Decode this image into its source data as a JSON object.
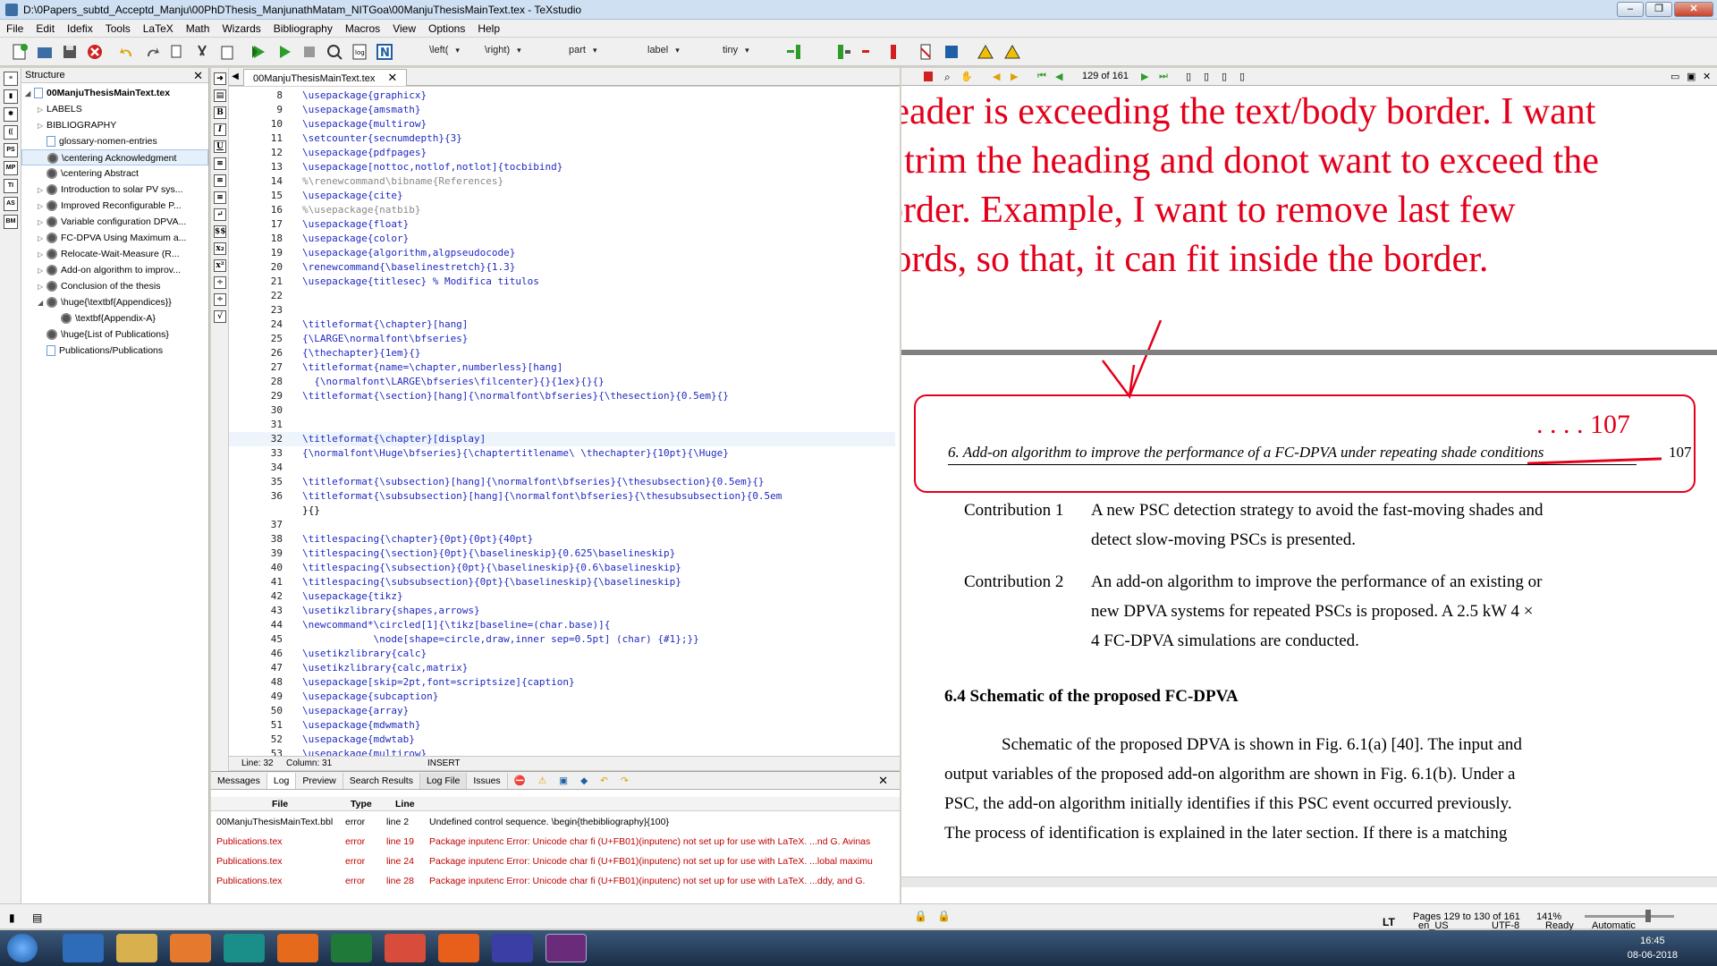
{
  "window": {
    "title": "D:\\0Papers_subtd_Acceptd_Manju\\00PhDThesis_ManjunathMatam_NITGoa\\00ManjuThesisMainText.tex - TeXstudio"
  },
  "menu": [
    "File",
    "Edit",
    "Idefix",
    "Tools",
    "LaTeX",
    "Math",
    "Wizards",
    "Bibliography",
    "Macros",
    "View",
    "Options",
    "Help"
  ],
  "toolbar": {
    "left": "\\left(",
    "right": "\\right)",
    "part": "part",
    "label": "label",
    "tiny": "tiny"
  },
  "structure": {
    "header": "Structure",
    "root": "00ManjuThesisMainText.tex",
    "items": [
      {
        "label": "LABELS",
        "kind": "folder"
      },
      {
        "label": "BIBLIOGRAPHY",
        "kind": "folder"
      },
      {
        "label": "glossary-nomen-entries",
        "kind": "file"
      },
      {
        "label": "\\centering Acknowledgment",
        "kind": "chapter"
      },
      {
        "label": "\\centering Abstract",
        "kind": "chapter"
      },
      {
        "label": "Introduction to solar PV sys...",
        "kind": "chapter"
      },
      {
        "label": "Improved Reconfigurable P...",
        "kind": "chapter"
      },
      {
        "label": "Variable configuration DPVA...",
        "kind": "chapter"
      },
      {
        "label": "FC-DPVA Using Maximum a...",
        "kind": "chapter"
      },
      {
        "label": "Relocate-Wait-Measure (R...",
        "kind": "chapter"
      },
      {
        "label": "Add-on algorithm to improv...",
        "kind": "chapter"
      },
      {
        "label": "Conclusion of the thesis",
        "kind": "chapter"
      },
      {
        "label": "\\huge{\\textbf{Appendices}}",
        "kind": "chapter"
      },
      {
        "label": "\\textbf{Appendix-A}",
        "kind": "section"
      },
      {
        "label": "\\huge{List of Publications}",
        "kind": "chapter"
      },
      {
        "label": "Publications/Publications",
        "kind": "file"
      }
    ]
  },
  "editor": {
    "tab": "00ManjuThesisMainText.tex",
    "lines": [
      {
        "n": "8",
        "t": "\\usepackage{graphicx}"
      },
      {
        "n": "9",
        "t": "\\usepackage{amsmath}"
      },
      {
        "n": "10",
        "t": "\\usepackage{multirow}"
      },
      {
        "n": "11",
        "t": "\\setcounter{secnumdepth}{3}"
      },
      {
        "n": "12",
        "t": "\\usepackage{pdfpages}"
      },
      {
        "n": "13",
        "t": "\\usepackage[nottoc,notlof,notlot]{tocbibind}"
      },
      {
        "n": "14",
        "t": "%\\renewcommand\\bibname{References}"
      },
      {
        "n": "15",
        "t": "\\usepackage{cite}"
      },
      {
        "n": "16",
        "t": "%\\usepackage{natbib}"
      },
      {
        "n": "17",
        "t": "\\usepackage{float}"
      },
      {
        "n": "18",
        "t": "\\usepackage{color}"
      },
      {
        "n": "19",
        "t": "\\usepackage{algorithm,algpseudocode}"
      },
      {
        "n": "20",
        "t": "\\renewcommand{\\baselinestretch}{1.3}"
      },
      {
        "n": "21",
        "t": "\\usepackage{titlesec} % Modifica titulos"
      },
      {
        "n": "22",
        "t": ""
      },
      {
        "n": "23",
        "t": ""
      },
      {
        "n": "24",
        "t": "\\titleformat{\\chapter}[hang]"
      },
      {
        "n": "25",
        "t": "{\\LARGE\\normalfont\\bfseries}"
      },
      {
        "n": "26",
        "t": "{\\thechapter}{1em}{}"
      },
      {
        "n": "27",
        "t": "\\titleformat{name=\\chapter,numberless}[hang]"
      },
      {
        "n": "28",
        "t": "  {\\normalfont\\LARGE\\bfseries\\filcenter}{}{1ex}{}{}"
      },
      {
        "n": "29",
        "t": "\\titleformat{\\section}[hang]{\\normalfont\\bfseries}{\\thesection}{0.5em}{}"
      },
      {
        "n": "30",
        "t": ""
      },
      {
        "n": "31",
        "t": ""
      },
      {
        "n": "32",
        "t": "\\titleformat{\\chapter}[display]"
      },
      {
        "n": "33",
        "t": "{\\normalfont\\Huge\\bfseries}{\\chaptertitlename\\ \\thechapter}{10pt}{\\Huge}"
      },
      {
        "n": "34",
        "t": ""
      },
      {
        "n": "35",
        "t": "\\titleformat{\\subsection}[hang]{\\normalfont\\bfseries}{\\thesubsection}{0.5em}{}"
      },
      {
        "n": "36",
        "t": "\\titleformat{\\subsubsection}[hang]{\\normalfont\\bfseries}{\\thesubsubsection}{0.5em"
      },
      {
        "n": "",
        "t": "}{}"
      },
      {
        "n": "37",
        "t": ""
      },
      {
        "n": "38",
        "t": "\\titlespacing{\\chapter}{0pt}{0pt}{40pt}"
      },
      {
        "n": "39",
        "t": "\\titlespacing{\\section}{0pt}{\\baselineskip}{0.625\\baselineskip}"
      },
      {
        "n": "40",
        "t": "\\titlespacing{\\subsection}{0pt}{\\baselineskip}{0.6\\baselineskip}"
      },
      {
        "n": "41",
        "t": "\\titlespacing{\\subsubsection}{0pt}{\\baselineskip}{\\baselineskip}"
      },
      {
        "n": "42",
        "t": "\\usepackage{tikz}"
      },
      {
        "n": "43",
        "t": "\\usetikzlibrary{shapes,arrows}"
      },
      {
        "n": "44",
        "t": "\\newcommand*\\circled[1]{\\tikz[baseline=(char.base)]{"
      },
      {
        "n": "45",
        "t": "            \\node[shape=circle,draw,inner sep=0.5pt] (char) {#1};}}"
      },
      {
        "n": "46",
        "t": "\\usetikzlibrary{calc}"
      },
      {
        "n": "47",
        "t": "\\usetikzlibrary{calc,matrix}"
      },
      {
        "n": "48",
        "t": "\\usepackage[skip=2pt,font=scriptsize]{caption}"
      },
      {
        "n": "49",
        "t": "\\usepackage{subcaption}"
      },
      {
        "n": "50",
        "t": "\\usepackage{array}"
      },
      {
        "n": "51",
        "t": "\\usepackage{mdwmath}"
      },
      {
        "n": "52",
        "t": "\\usepackage{mdwtab}"
      },
      {
        "n": "53",
        "t": "\\usepackage{multirow}"
      }
    ],
    "footer": {
      "line": "Line: 32",
      "column": "Column: 31",
      "mode": "INSERT"
    }
  },
  "bottom": {
    "tabs": [
      "Messages",
      "Log",
      "Preview",
      "Search Results",
      "Log File",
      "Issues"
    ],
    "headers": {
      "file": "File",
      "type": "Type",
      "line": "Line"
    },
    "rows": [
      {
        "file": "00ManjuThesisMainText.bbl",
        "type": "error",
        "line": "line 2",
        "msg": "Undefined control sequence. \\begin{thebibliography}{100}"
      },
      {
        "file": "Publications.tex",
        "type": "error",
        "line": "line 19",
        "msg": "Package inputenc Error: Unicode char fi (U+FB01)(inputenc) not set up for use with LaTeX. ...nd G. Avinas"
      },
      {
        "file": "Publications.tex",
        "type": "error",
        "line": "line 24",
        "msg": "Package inputenc Error: Unicode char fi (U+FB01)(inputenc) not set up for use with LaTeX. ...lobal maximu"
      },
      {
        "file": "Publications.tex",
        "type": "error",
        "line": "line 28",
        "msg": "Package inputenc Error: Unicode char fi (U+FB01)(inputenc) not set up for use with LaTeX. ...ddy, and G."
      }
    ]
  },
  "viewer": {
    "page": "129",
    "of": "of 161",
    "annotation": [
      "Header is exceeding the text/body  border. I want",
      "to trim the heading and donot want to exceed the",
      "border. Example, I want to remove last few",
      "words, so that, it can fit inside the border."
    ],
    "handwritten": ". . . .  107",
    "runhead": "6.  Add-on algorithm to improve the performance of a FC-DPVA under repeating shade conditions",
    "pagenum": "107",
    "contrib1_label": "Contribution 1",
    "contrib1_l1": "A new PSC detection strategy to avoid the fast-moving shades and",
    "contrib1_l2": "detect slow-moving PSCs is presented.",
    "contrib2_label": "Contribution 2",
    "contrib2_l1": "An add-on algorithm to improve the performance of an existing or",
    "contrib2_l2": "new DPVA systems for repeated PSCs is proposed.  A 2.5 kW 4 ×",
    "contrib2_l3": "4 FC-DPVA simulations are conducted.",
    "section": "6.4  Schematic of the proposed FC-DPVA",
    "p1": "Schematic of the proposed DPVA is shown in Fig. 6.1(a) [40].  The input and",
    "p2": "output variables of the proposed add-on algorithm are shown in Fig. 6.1(b).  Under a",
    "p3": "PSC, the add-on algorithm initially identifies if this PSC event occurred previously.",
    "p4": "The process of identification is explained in the later section.  If there is a matching",
    "pages": "Pages 129 to 130 of 161",
    "zoom": "141%"
  },
  "status": {
    "lang": "en_US",
    "encoding": "UTF-8",
    "ready": "Ready",
    "auto": "Automatic"
  },
  "taskbar": {
    "time": "16:45",
    "date": "08-06-2018"
  }
}
